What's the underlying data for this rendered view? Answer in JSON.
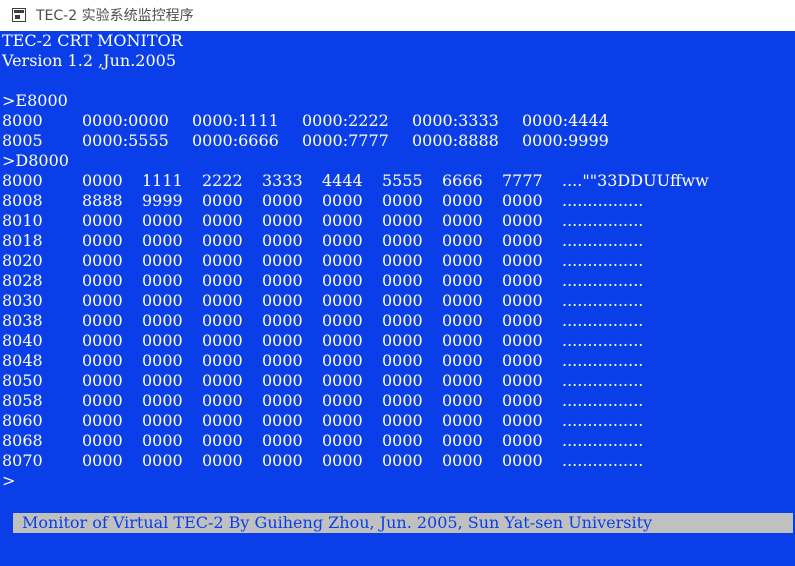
{
  "window": {
    "title": "TEC-2 实验系统监控程序"
  },
  "console": {
    "header": [
      "TEC-2 CRT MONITOR",
      "Version 1.2 ,Jun.2005"
    ],
    "e_command": ">E8000",
    "e_rows": [
      {
        "addr": "8000",
        "cells": [
          "0000:0000",
          "0000:1111",
          "0000:2222",
          "0000:3333",
          "0000:4444"
        ]
      },
      {
        "addr": "8005",
        "cells": [
          "0000:5555",
          "0000:6666",
          "0000:7777",
          "0000:8888",
          "0000:9999"
        ]
      }
    ],
    "d_command": ">D8000",
    "d_rows": [
      {
        "addr": "8000",
        "words": [
          "0000",
          "1111",
          "2222",
          "3333",
          "4444",
          "5555",
          "6666",
          "7777"
        ],
        "ascii": "....\"\"33DDUUffww"
      },
      {
        "addr": "8008",
        "words": [
          "8888",
          "9999",
          "0000",
          "0000",
          "0000",
          "0000",
          "0000",
          "0000"
        ],
        "ascii": "................"
      },
      {
        "addr": "8010",
        "words": [
          "0000",
          "0000",
          "0000",
          "0000",
          "0000",
          "0000",
          "0000",
          "0000"
        ],
        "ascii": "................"
      },
      {
        "addr": "8018",
        "words": [
          "0000",
          "0000",
          "0000",
          "0000",
          "0000",
          "0000",
          "0000",
          "0000"
        ],
        "ascii": "................"
      },
      {
        "addr": "8020",
        "words": [
          "0000",
          "0000",
          "0000",
          "0000",
          "0000",
          "0000",
          "0000",
          "0000"
        ],
        "ascii": "................"
      },
      {
        "addr": "8028",
        "words": [
          "0000",
          "0000",
          "0000",
          "0000",
          "0000",
          "0000",
          "0000",
          "0000"
        ],
        "ascii": "................"
      },
      {
        "addr": "8030",
        "words": [
          "0000",
          "0000",
          "0000",
          "0000",
          "0000",
          "0000",
          "0000",
          "0000"
        ],
        "ascii": "................"
      },
      {
        "addr": "8038",
        "words": [
          "0000",
          "0000",
          "0000",
          "0000",
          "0000",
          "0000",
          "0000",
          "0000"
        ],
        "ascii": "................"
      },
      {
        "addr": "8040",
        "words": [
          "0000",
          "0000",
          "0000",
          "0000",
          "0000",
          "0000",
          "0000",
          "0000"
        ],
        "ascii": "................"
      },
      {
        "addr": "8048",
        "words": [
          "0000",
          "0000",
          "0000",
          "0000",
          "0000",
          "0000",
          "0000",
          "0000"
        ],
        "ascii": "................"
      },
      {
        "addr": "8050",
        "words": [
          "0000",
          "0000",
          "0000",
          "0000",
          "0000",
          "0000",
          "0000",
          "0000"
        ],
        "ascii": "................"
      },
      {
        "addr": "8058",
        "words": [
          "0000",
          "0000",
          "0000",
          "0000",
          "0000",
          "0000",
          "0000",
          "0000"
        ],
        "ascii": "................"
      },
      {
        "addr": "8060",
        "words": [
          "0000",
          "0000",
          "0000",
          "0000",
          "0000",
          "0000",
          "0000",
          "0000"
        ],
        "ascii": "................"
      },
      {
        "addr": "8068",
        "words": [
          "0000",
          "0000",
          "0000",
          "0000",
          "0000",
          "0000",
          "0000",
          "0000"
        ],
        "ascii": "................"
      },
      {
        "addr": "8070",
        "words": [
          "0000",
          "0000",
          "0000",
          "0000",
          "0000",
          "0000",
          "0000",
          "0000"
        ],
        "ascii": "................"
      }
    ],
    "prompt": ">"
  },
  "status_bar": {
    "text": "Monitor of Virtual TEC-2 By Guiheng Zhou, Jun. 2005, Sun Yat-sen University"
  },
  "colors": {
    "console_background": "#0a3ee8",
    "console_text": "#ffffff",
    "status_background": "#c0c0c0",
    "status_text": "#0a3ee8"
  }
}
